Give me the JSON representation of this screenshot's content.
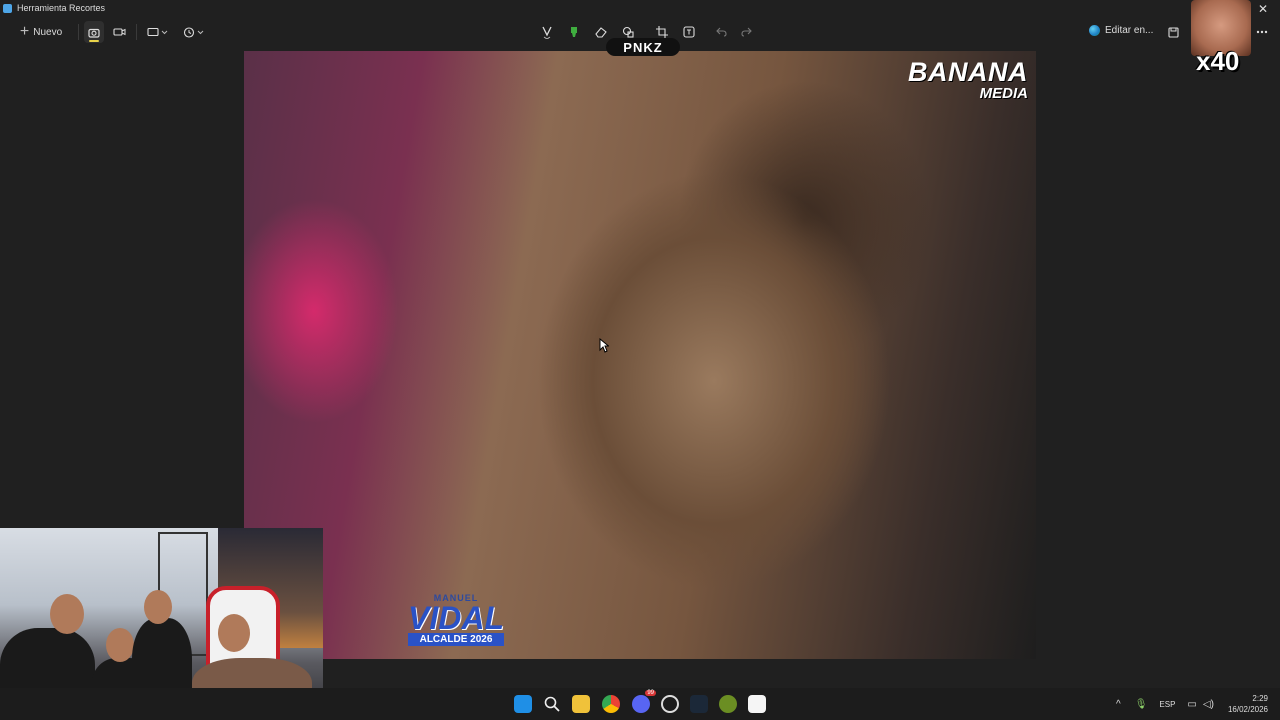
{
  "window": {
    "title": "Herramienta Recortes"
  },
  "toolbar": {
    "new_label": "Nuevo",
    "edit_in_label": "Editar en...",
    "accent_color": "#e8d34a",
    "icons": [
      "camera-icon",
      "video-icon",
      "rectangle-mode-icon",
      "delay-timer-icon",
      "pen-icon",
      "highlighter-icon",
      "eraser-icon",
      "shapes-icon",
      "crop-icon",
      "text-actions-icon",
      "undo-icon",
      "redo-icon",
      "save-icon",
      "more-icon"
    ]
  },
  "overlays": {
    "tag": "PNKZ",
    "emote_count": "x40"
  },
  "screenshot": {
    "brand_line1": "BANANA",
    "brand_line2": "MEDIA",
    "campaign_line1": "MANUEL",
    "campaign_line2": "VIDAL",
    "campaign_line3": "ALCALDE 2026"
  },
  "taskbar": {
    "notification_badge": "99",
    "language": "ESP",
    "time": "2:29",
    "date": "16/02/2026"
  }
}
